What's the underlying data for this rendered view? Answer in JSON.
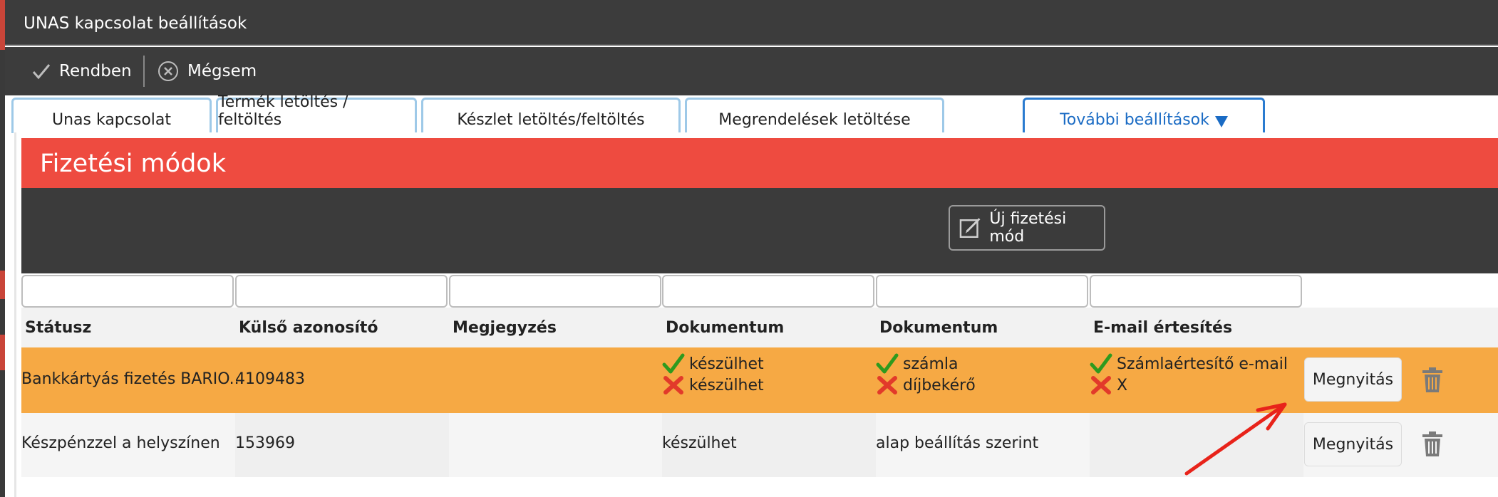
{
  "window": {
    "title": "UNAS kapcsolat beállítások"
  },
  "toolbar": {
    "ok_label": "Rendben",
    "cancel_label": "Mégsem"
  },
  "tabs": [
    {
      "label": "Unas kapcsolat"
    },
    {
      "label": "Termék letöltés / feltöltés"
    },
    {
      "label": "Készlet letöltés/feltöltés"
    },
    {
      "label": "Megrendelések letöltése"
    },
    {
      "label": "További beállítások",
      "active": true
    }
  ],
  "section": {
    "title": "Fizetési módok",
    "new_button_label": "Új fizetési mód"
  },
  "filters": [
    "",
    "",
    "",
    "",
    "",
    ""
  ],
  "table": {
    "headers": [
      "Státusz",
      "Külső azonosító",
      "Megjegyzés",
      "Dokumentum",
      "Dokumentum",
      "E-mail értesítés"
    ],
    "rows": [
      {
        "status": "Bankkártyás fizetés BARIO...",
        "external_id": "4109483",
        "note": "",
        "doc1": [
          {
            "icon": "check-icon",
            "text": "készülhet"
          },
          {
            "icon": "cross-icon",
            "text": "készülhet"
          }
        ],
        "doc2": [
          {
            "icon": "check-icon",
            "text": "számla"
          },
          {
            "icon": "cross-icon",
            "text": "díjbekérő"
          }
        ],
        "email": [
          {
            "icon": "check-icon",
            "text": "Számlaértesítő e-mail"
          },
          {
            "icon": "cross-icon",
            "text": "X"
          }
        ],
        "open_label": "Megnyitás",
        "highlight": "#f6a944"
      },
      {
        "status": "Készpénzzel a helyszínen",
        "external_id": "153969",
        "note": "",
        "doc1_text": "készülhet",
        "doc2_text": "alap beállítás szerint",
        "email_text": "",
        "open_label": "Megnyitás"
      }
    ]
  },
  "colors": {
    "header_red": "#ee4b40",
    "dark_bar": "#3b3b3b",
    "row_highlight": "#f6a944",
    "active_tab": "#2a7bd0",
    "annotation_arrow": "#e8231a"
  }
}
